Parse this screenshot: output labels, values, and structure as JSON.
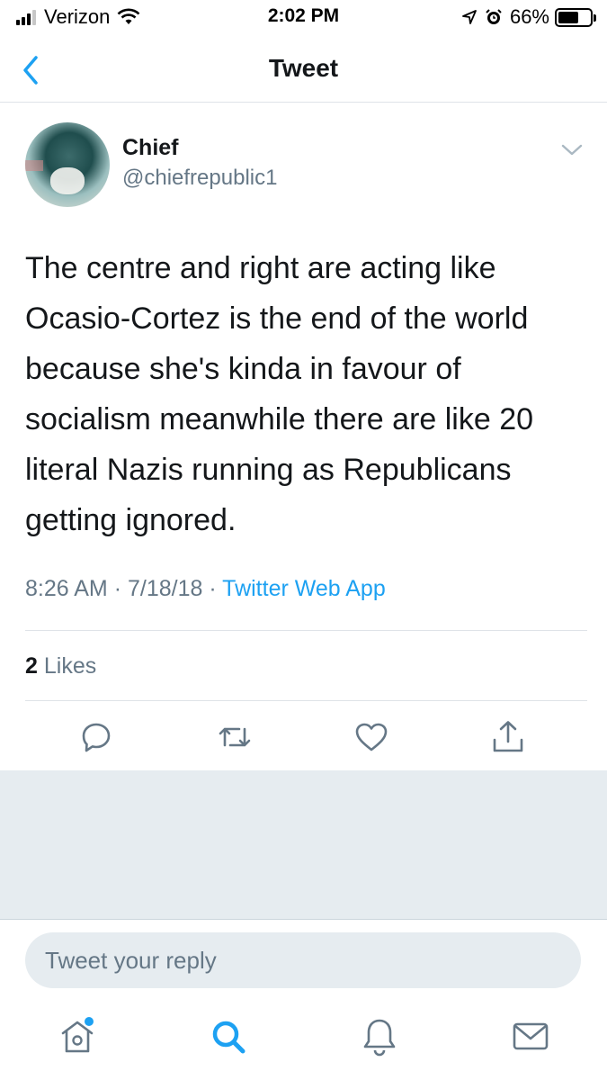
{
  "status_bar": {
    "carrier": "Verizon",
    "time": "2:02 PM",
    "battery_percent": "66%",
    "battery_level": 0.66,
    "icons": [
      "signal-icon",
      "wifi-icon",
      "location-icon",
      "alarm-icon",
      "battery-icon"
    ]
  },
  "nav": {
    "back_icon": "chevron-left-icon",
    "title": "Tweet"
  },
  "tweet": {
    "author_name": "Chief",
    "author_handle": "@chiefrepublic1",
    "text": "The centre and right are acting like Ocasio-Cortez is the end of the world because she's kinda in favour of socialism meanwhile there are like 20 literal Nazis running as Republicans getting ignored.",
    "time": "8:26 AM",
    "date": "7/18/18",
    "separator": "·",
    "source": "Twitter Web App",
    "likes_count": "2",
    "likes_label": "Likes"
  },
  "actions": [
    "reply-icon",
    "retweet-icon",
    "like-icon",
    "share-icon"
  ],
  "reply": {
    "placeholder": "Tweet your reply"
  },
  "tabbar": {
    "items": [
      "home-icon",
      "search-icon",
      "notifications-icon",
      "messages-icon"
    ]
  },
  "colors": {
    "accent": "#1da1f2",
    "secondary_text": "#657786",
    "background_gray": "#e6ecf0"
  }
}
